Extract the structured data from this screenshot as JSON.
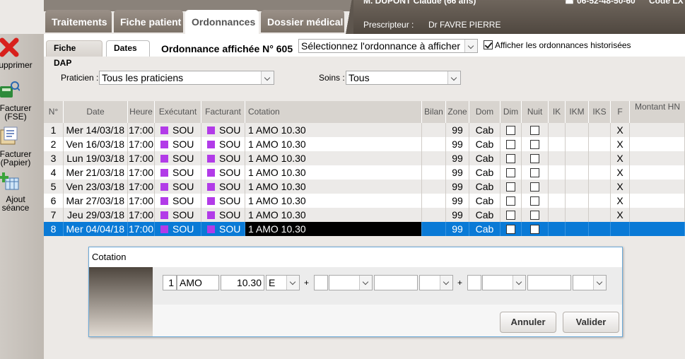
{
  "header": {
    "patient": "M. DUPONT Claude (66 ans)",
    "phone": "06-52-48-50-60",
    "code_label": "Code LX",
    "prescripteur_label": "Prescripteur :",
    "prescripteur_value": "Dr FAVRE PIERRE"
  },
  "main_tabs": [
    {
      "label": "Traitements"
    },
    {
      "label": "Fiche patient"
    },
    {
      "label": "Ordonnances"
    },
    {
      "label": "Dossier médical"
    }
  ],
  "sidebar": [
    {
      "label": "upprimer",
      "icon": "delete-icon"
    },
    {
      "label": "Facturer\n(FSE)",
      "icon": "card-reader-icon"
    },
    {
      "label": "Facturer\n(Papier)",
      "icon": "paper-invoice-icon"
    },
    {
      "label": "Ajout\nséance",
      "icon": "add-session-icon"
    }
  ],
  "sub_tabs": [
    {
      "label": "Fiche DAP"
    },
    {
      "label": "Dates"
    }
  ],
  "ordonnance_title": "Ordonnance affichée N° 605",
  "ordonnance_select": "Sélectionnez l'ordonnance à afficher",
  "historise_label": "Afficher les ordonnances historisées",
  "filters": {
    "praticien_label": "Praticien :",
    "praticien_value": "Tous les praticiens",
    "soins_label": "Soins :",
    "soins_value": "Tous"
  },
  "table": {
    "columns": [
      "N°",
      "Date",
      "Heure",
      "Exécutant",
      "Facturant",
      "Cotation",
      "Bilan",
      "Zone",
      "Dom",
      "Dim",
      "Nuit",
      "IK",
      "IKM",
      "IKS",
      "F",
      "Montant HN"
    ],
    "rows": [
      {
        "n": "1",
        "date": "Mer 14/03/18",
        "heure": "17:00",
        "executant": "SOU",
        "facturant": "SOU",
        "cotation": "1 AMO 10.30",
        "zone": "99",
        "dom": "Cab",
        "f": "X"
      },
      {
        "n": "2",
        "date": "Ven 16/03/18",
        "heure": "17:00",
        "executant": "SOU",
        "facturant": "SOU",
        "cotation": "1 AMO 10.30",
        "zone": "99",
        "dom": "Cab",
        "f": "X"
      },
      {
        "n": "3",
        "date": "Lun 19/03/18",
        "heure": "17:00",
        "executant": "SOU",
        "facturant": "SOU",
        "cotation": "1 AMO 10.30",
        "zone": "99",
        "dom": "Cab",
        "f": "X"
      },
      {
        "n": "4",
        "date": "Mer 21/03/18",
        "heure": "17:00",
        "executant": "SOU",
        "facturant": "SOU",
        "cotation": "1 AMO 10.30",
        "zone": "99",
        "dom": "Cab",
        "f": "X"
      },
      {
        "n": "5",
        "date": "Ven 23/03/18",
        "heure": "17:00",
        "executant": "SOU",
        "facturant": "SOU",
        "cotation": "1 AMO 10.30",
        "zone": "99",
        "dom": "Cab",
        "f": "X"
      },
      {
        "n": "6",
        "date": "Mar 27/03/18",
        "heure": "17:00",
        "executant": "SOU",
        "facturant": "SOU",
        "cotation": "1 AMO 10.30",
        "zone": "99",
        "dom": "Cab",
        "f": "X"
      },
      {
        "n": "7",
        "date": "Jeu 29/03/18",
        "heure": "17:00",
        "executant": "SOU",
        "facturant": "SOU",
        "cotation": "1 AMO 10.30",
        "zone": "99",
        "dom": "Cab",
        "f": "X"
      },
      {
        "n": "8",
        "date": "Mer 04/04/18",
        "heure": "17:00",
        "executant": "SOU",
        "facturant": "SOU",
        "cotation": "1 AMO 10.30",
        "zone": "99",
        "dom": "Cab",
        "f": ""
      }
    ]
  },
  "dialog": {
    "title": "Cotation",
    "qty": "1",
    "code": "AMO",
    "coef": "10.30",
    "type": "E",
    "plus1": "+",
    "plus2": "+",
    "cancel_label": "Annuler",
    "ok_label": "Valider"
  },
  "colors": {
    "selected_row": "#0a7ad6",
    "practitioner_swatch": "#b23be8"
  }
}
